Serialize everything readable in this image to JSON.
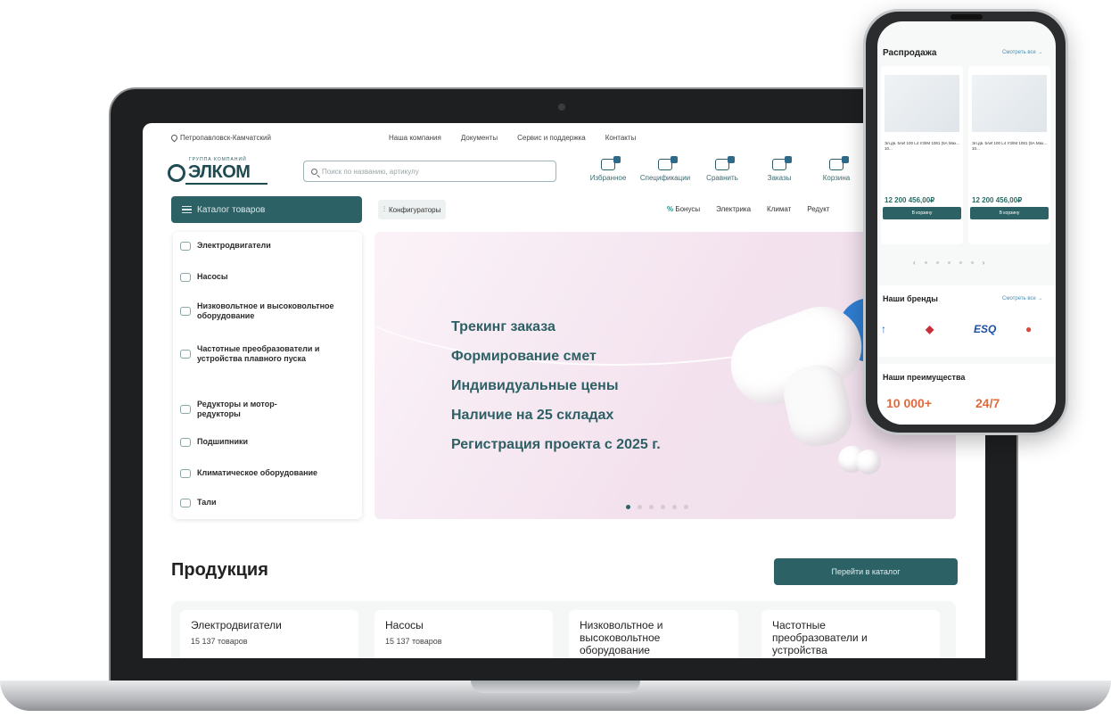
{
  "site": {
    "city": "Петропавловск-Камчатский",
    "top_links": [
      "Наша компания",
      "Документы",
      "Сервис и поддержка",
      "Контакты"
    ],
    "logo_tagline": "ГРУППА КОМПАНИЙ",
    "logo_text": "ЭЛКОМ",
    "search_placeholder": "Поиск по названию, артикулу",
    "header_icons": [
      "Избранное",
      "Спецификации",
      "Сравнить",
      "Заказы",
      "Корзина"
    ],
    "catalog_button": "Каталог товаров",
    "configurators_button": "Конфигураторы",
    "nav_links": [
      "Бонусы",
      "Электрика",
      "Климат",
      "Редукт"
    ],
    "side_menu": [
      "Электродвигатели",
      "Насосы",
      "Низковольтное и высоковольтное оборудование",
      "Частотные преобразователи и устройства плавного пуска",
      "Редукторы и мотор-редукторы",
      "Подшипники",
      "Климатическое оборудование",
      "Тали"
    ],
    "hero_bullets": [
      "Трекинг заказа",
      "Формирование смет",
      "Индивидуальные цены",
      "Наличие на 25 складах",
      "Регистрация проекта с 2025 г."
    ],
    "products_title": "Продукция",
    "products_button": "Перейти в каталог",
    "product_cards": [
      {
        "name": "Электродвигатели",
        "count": "15 137 товаров"
      },
      {
        "name": "Насосы",
        "count": "15 137 товаров"
      },
      {
        "name": "Низковольтное и высоковольтное оборудование",
        "count": ""
      },
      {
        "name": "Частотные преобразователи и устройства",
        "count": ""
      }
    ]
  },
  "phone": {
    "sale_title": "Распродажа",
    "see_all": "Смотреть все →",
    "cards": [
      {
        "meta": "Эл.дв. 5АИ 100 L4 У3/IМ 1081 (5А Мах... 10...",
        "price": "12 200 456,00₽",
        "buy": "В корзину"
      },
      {
        "meta": "Эл.дв. 5АИ 100 L4 У3/IМ 1081 (5А Мах... 10...",
        "price": "12 200 456,00₽",
        "buy": "В корзину"
      }
    ],
    "brands_title": "Наши бренды",
    "brands_see_all": "Смотреть все →",
    "brands": [
      "ESQ"
    ],
    "advantages_title": "Наши преимущества",
    "advantages": [
      "10 000+",
      "24/7"
    ]
  },
  "colors": {
    "primary": "#2c6166",
    "hero_text": "#2d5f65",
    "hero_bg": "#f3e2ee",
    "accent_orange": "#e06a3c"
  }
}
